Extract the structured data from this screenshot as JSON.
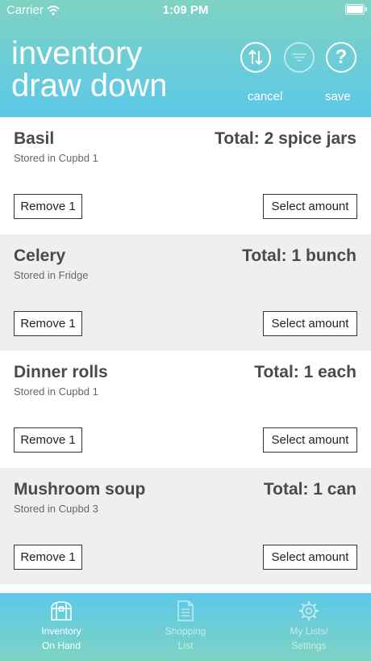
{
  "status_bar": {
    "carrier": "Carrier",
    "time": "1:09 PM"
  },
  "header": {
    "title_line1": "inventory",
    "title_line2": "draw down",
    "help_glyph": "?",
    "cancel_label": "cancel",
    "save_label": "save"
  },
  "items": [
    {
      "name": "Basil",
      "location": "Stored in Cupbd 1",
      "total": "Total: 2 spice jars",
      "remove_label": "Remove 1",
      "select_label": "Select amount"
    },
    {
      "name": "Celery",
      "location": "Stored in Fridge",
      "total": "Total: 1 bunch",
      "remove_label": "Remove 1",
      "select_label": "Select amount"
    },
    {
      "name": "Dinner rolls",
      "location": "Stored in Cupbd 1",
      "total": "Total: 1 each",
      "remove_label": "Remove 1",
      "select_label": "Select amount"
    },
    {
      "name": "Mushroom soup",
      "location": "Stored in Cupbd 3",
      "total": "Total: 1 can",
      "remove_label": "Remove 1",
      "select_label": "Select amount"
    }
  ],
  "tabs": [
    {
      "line1": "Inventory",
      "line2": "On Hand",
      "icon": "treasure-chest-icon",
      "active": true
    },
    {
      "line1": "Shopping",
      "line2": "List",
      "icon": "document-list-icon",
      "active": false
    },
    {
      "line1": "My Lists/",
      "line2": "Settings",
      "icon": "gear-icon",
      "active": false
    }
  ],
  "colors": {
    "header_top": "#7ed3c3",
    "header_bottom": "#5cc8e8",
    "alt_row": "#efefef",
    "text": "#4a4a4a"
  }
}
